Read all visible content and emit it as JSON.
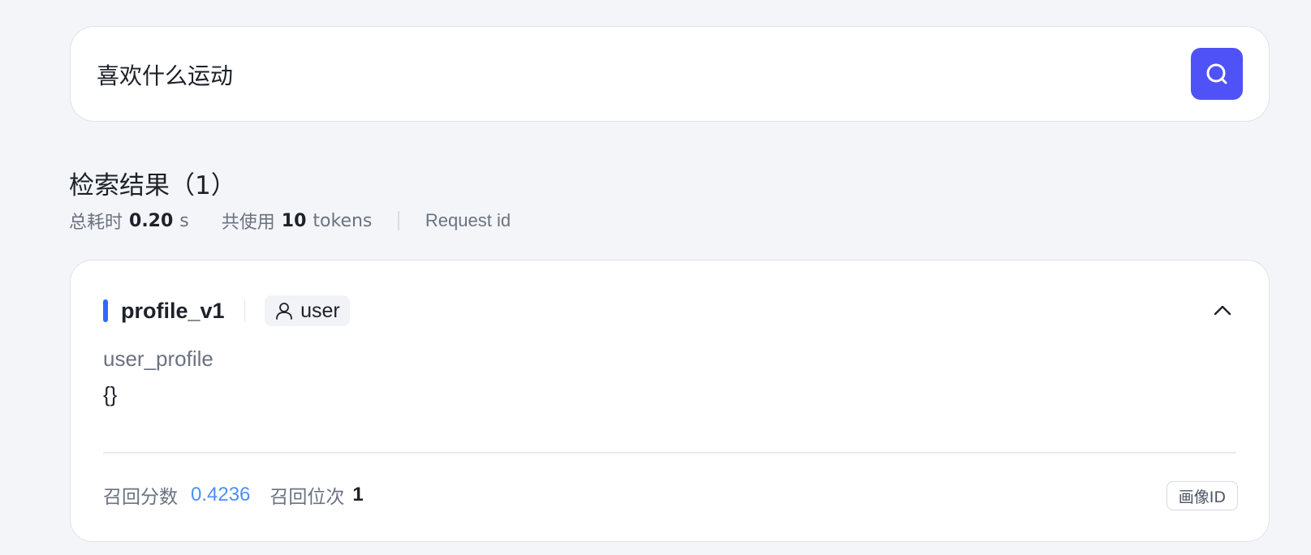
{
  "search": {
    "query": "喜欢什么运动",
    "button_icon": "search-icon",
    "button_color": "#4f52f7"
  },
  "results": {
    "title": "检索结果（1）",
    "stats": {
      "time_label": "总耗时",
      "time_value": "0.20",
      "time_unit": "s",
      "tokens_label": "共使用",
      "tokens_value": "10",
      "tokens_unit": "tokens",
      "request_id_label": "Request id"
    }
  },
  "result_card": {
    "accent_color": "#3366ff",
    "name": "profile_v1",
    "tag_icon": "user-icon",
    "tag_label": "user",
    "collapse_icon": "chevron-up-icon",
    "type_label": "user_profile",
    "content": "{}",
    "footer": {
      "score_label": "召回分数",
      "score_value": "0.4236",
      "rank_label": "召回位次",
      "rank_value": "1",
      "id_button_label": "画像ID"
    }
  }
}
